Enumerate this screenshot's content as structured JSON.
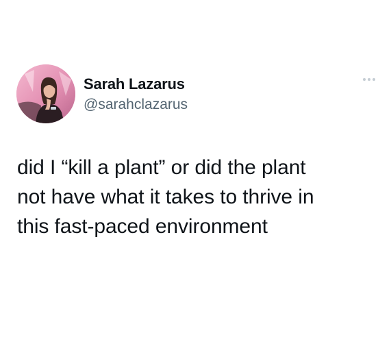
{
  "tweet": {
    "author": {
      "name": "Sarah Lazarus",
      "handle": "@sarahclazarus",
      "avatar_icon": "profile-photo"
    },
    "more_icon": "ellipsis-icon",
    "text_lines": [
      "did I “kill a plant” or did the plant",
      "not have what it takes to thrive in",
      "this fast-paced environment"
    ]
  },
  "colors": {
    "text": "#0f1419",
    "secondary_text": "#536471",
    "background": "#ffffff"
  }
}
